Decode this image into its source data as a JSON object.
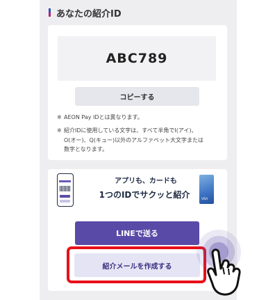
{
  "section": {
    "title": "あなたの紹介ID"
  },
  "id_card": {
    "referral_id": "ABC789",
    "copy_button": "コピーする",
    "notes": [
      {
        "mark": "※",
        "lines": [
          "AEON Pay IDとは異なります。"
        ]
      },
      {
        "mark": "※",
        "lines": [
          "紹介IDに使用している文字は、すべて半角でI(アイ)、",
          "O(オー)、Q(キュー)以外のアルファベット大文字または",
          "数字となります。"
        ]
      }
    ]
  },
  "promo": {
    "line1": "アプリも、カードも",
    "line2": "1つのIDでサクッと紹介",
    "card_brand": "VISA"
  },
  "actions": {
    "line_button": "LINEで送る",
    "mail_button": "紹介メールを作成する"
  },
  "colors": {
    "primary_purple": "#5a4aa8",
    "mail_button_bg": "#e5e4f4",
    "highlight_red": "#e8101a"
  },
  "icons": [
    "phone-app-icon",
    "credit-card-icon",
    "pointing-hand-icon"
  ]
}
